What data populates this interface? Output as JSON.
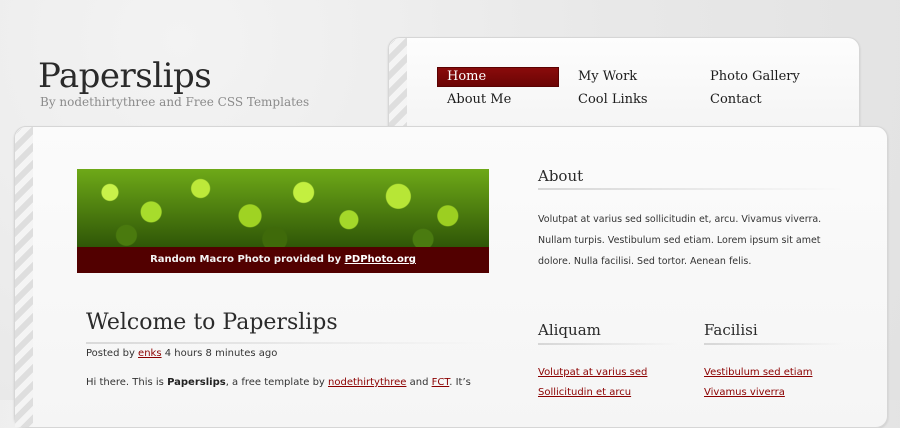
{
  "header": {
    "title": "Paperslips",
    "subtitle": "By nodethirtythree and Free CSS Templates"
  },
  "nav": {
    "items": [
      {
        "label": "Home",
        "active": true
      },
      {
        "label": "My Work",
        "active": false
      },
      {
        "label": "Photo Gallery",
        "active": false
      },
      {
        "label": "About Me",
        "active": false
      },
      {
        "label": "Cool Links",
        "active": false
      },
      {
        "label": "Contact",
        "active": false
      }
    ]
  },
  "photo": {
    "caption_prefix": "Random Macro Photo provided by ",
    "caption_link": "PDPhoto.org"
  },
  "post": {
    "title": "Welcome to Paperslips",
    "meta_prefix": "Posted by ",
    "author": "enks",
    "meta_suffix": " 4 hours 8 minutes ago",
    "body_1": "Hi there. This is ",
    "body_bold": "Paperslips",
    "body_2": ", a free template by ",
    "body_link1": "nodethirtythree",
    "body_3": " and ",
    "body_link2": "FCT",
    "body_4": ". It’s"
  },
  "sidebar": {
    "about": {
      "heading": "About",
      "text": "Volutpat at varius sed sollicitudin et, arcu. Vivamus viverra. Nullam turpis. Vestibulum sed etiam. Lorem ipsum sit amet dolore. Nulla facilisi. Sed tortor. Aenean felis."
    },
    "aliquam": {
      "heading": "Aliquam",
      "links": [
        "Volutpat at varius sed",
        "Sollicitudin et arcu"
      ]
    },
    "facilisi": {
      "heading": "Facilisi",
      "links": [
        "Vestibulum sed etiam",
        "Vivamus viverra"
      ]
    }
  },
  "colors": {
    "accent": "#8b0000",
    "caption_bg": "#520000",
    "page_bg": "#e8e8e8"
  }
}
